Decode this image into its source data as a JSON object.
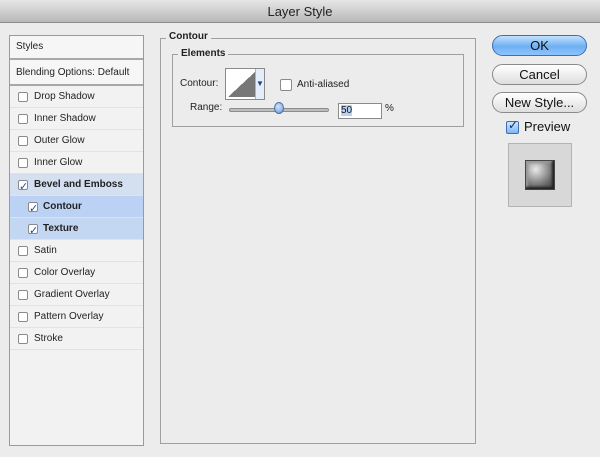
{
  "window": {
    "title": "Layer Style"
  },
  "styles_list": {
    "header": "Styles",
    "blending": "Blending Options: Default",
    "items": [
      {
        "label": "Drop Shadow",
        "checked": false,
        "level": 0
      },
      {
        "label": "Inner Shadow",
        "checked": false,
        "level": 0
      },
      {
        "label": "Outer Glow",
        "checked": false,
        "level": 0
      },
      {
        "label": "Inner Glow",
        "checked": false,
        "level": 0
      },
      {
        "label": "Bevel and Emboss",
        "checked": true,
        "level": 0
      },
      {
        "label": "Contour",
        "checked": true,
        "level": 1
      },
      {
        "label": "Texture",
        "checked": true,
        "level": 1
      },
      {
        "label": "Satin",
        "checked": false,
        "level": 0
      },
      {
        "label": "Color Overlay",
        "checked": false,
        "level": 0
      },
      {
        "label": "Gradient Overlay",
        "checked": false,
        "level": 0
      },
      {
        "label": "Pattern Overlay",
        "checked": false,
        "level": 0
      },
      {
        "label": "Stroke",
        "checked": false,
        "level": 0
      }
    ]
  },
  "panel": {
    "section_title": "Contour",
    "group_title": "Elements",
    "contour_label": "Contour:",
    "antialiased_label": "Anti-aliased",
    "antialiased_checked": false,
    "range_label": "Range:",
    "range_value": "50",
    "range_unit": "%"
  },
  "buttons": {
    "ok": "OK",
    "cancel": "Cancel",
    "new_style": "New Style..."
  },
  "preview": {
    "label": "Preview",
    "checked": true
  },
  "icons": {
    "contour_dropdown": "chevron-down-icon",
    "checkbox_checked": "check-icon"
  },
  "colors": {
    "selection_blue": "#c3d6f2",
    "primary_button": "#6fb0f2"
  }
}
